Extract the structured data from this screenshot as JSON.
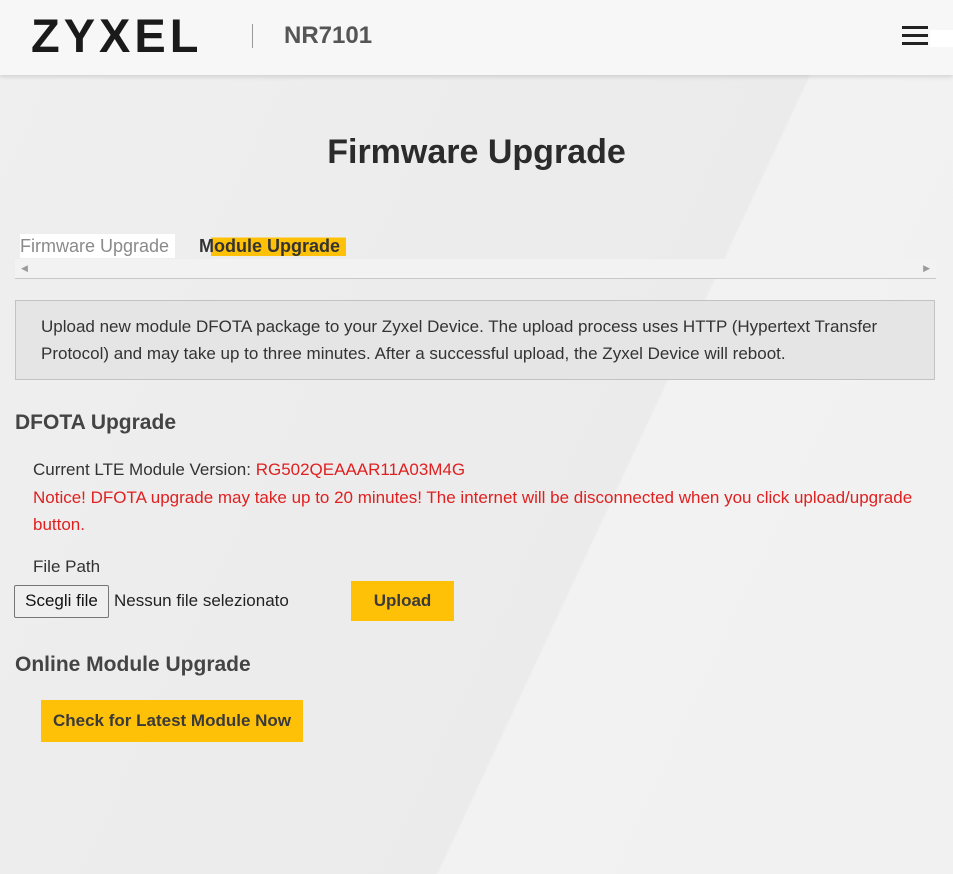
{
  "header": {
    "logo_text": "ZYXEL",
    "model": "NR7101",
    "menu_icon": "hamburger-menu-icon"
  },
  "page": {
    "title": "Firmware Upgrade"
  },
  "tabs": [
    {
      "label": "Firmware Upgrade",
      "active": false
    },
    {
      "label": "Module Upgrade",
      "active": true
    }
  ],
  "info_box": {
    "text": "Upload new module DFOTA package to your Zyxel Device. The upload process uses HTTP (Hypertext Transfer Protocol) and may take up to three minutes. After a successful upload, the Zyxel Device will reboot."
  },
  "dfota": {
    "title": "DFOTA Upgrade",
    "version_label": "Current LTE Module Version: ",
    "version_value": "RG502QEAAAR11A03M4G",
    "notice": "Notice! DFOTA upgrade may take up to 20 minutes! The internet will be disconnected when you click upload/upgrade button.",
    "file_path_label": "File Path",
    "choose_file_button": "Scegli file",
    "file_status": "Nessun file selezionato",
    "upload_button": "Upload"
  },
  "online": {
    "title": "Online Module Upgrade",
    "check_button": "Check for Latest Module Now"
  },
  "colors": {
    "accent": "#ffc107",
    "notice": "#e02020",
    "background": "#eeeeee"
  }
}
